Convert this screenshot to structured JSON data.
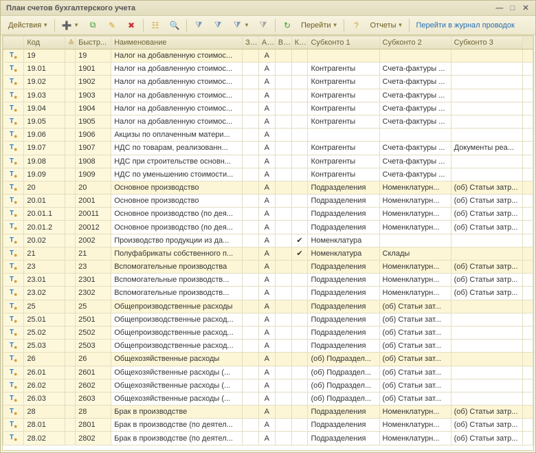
{
  "window": {
    "title": "План счетов бухгалтерского учета"
  },
  "toolbar": {
    "actions_label": "Действия",
    "goto_label": "Перейти",
    "reports_label": "Отчеты",
    "journal_label": "Перейти в журнал проводок"
  },
  "columns": {
    "icon": "",
    "code": "Код",
    "fast": "Быстр...",
    "name": "Наименование",
    "z": "З...",
    "a": "А...",
    "v": "В...",
    "k": "К...",
    "sub1": "Субконто 1",
    "sub2": "Субконто 2",
    "sub3": "Субконто 3"
  },
  "rows": [
    {
      "g": true,
      "code": "19",
      "fast": "19",
      "name": "Налог на добавленную стоимос...",
      "a": "А",
      "sub1": "",
      "sub2": "",
      "sub3": ""
    },
    {
      "code": "19.01",
      "fast": "1901",
      "name": "Налог на добавленную стоимос...",
      "a": "А",
      "sub1": "Контрагенты",
      "sub2": "Счета-фактуры ...",
      "sub3": ""
    },
    {
      "code": "19.02",
      "fast": "1902",
      "name": "Налог на добавленную стоимос...",
      "a": "А",
      "sub1": "Контрагенты",
      "sub2": "Счета-фактуры ...",
      "sub3": ""
    },
    {
      "code": "19.03",
      "fast": "1903",
      "name": "Налог на добавленную стоимос...",
      "a": "А",
      "sub1": "Контрагенты",
      "sub2": "Счета-фактуры ...",
      "sub3": ""
    },
    {
      "code": "19.04",
      "fast": "1904",
      "name": "Налог на добавленную стоимос...",
      "a": "А",
      "sub1": "Контрагенты",
      "sub2": "Счета-фактуры ...",
      "sub3": ""
    },
    {
      "code": "19.05",
      "fast": "1905",
      "name": "Налог на добавленную стоимос...",
      "a": "А",
      "sub1": "Контрагенты",
      "sub2": "Счета-фактуры ...",
      "sub3": ""
    },
    {
      "code": "19.06",
      "fast": "1906",
      "name": "Акцизы по оплаченным матери...",
      "a": "А",
      "sub1": "",
      "sub2": "",
      "sub3": ""
    },
    {
      "code": "19.07",
      "fast": "1907",
      "name": "НДС по товарам, реализованн...",
      "a": "А",
      "sub1": "Контрагенты",
      "sub2": "Счета-фактуры ...",
      "sub3": "Документы реа..."
    },
    {
      "code": "19.08",
      "fast": "1908",
      "name": "НДС при строительстве основн...",
      "a": "А",
      "sub1": "Контрагенты",
      "sub2": "Счета-фактуры ...",
      "sub3": ""
    },
    {
      "code": "19.09",
      "fast": "1909",
      "name": "НДС по уменьшению стоимости...",
      "a": "А",
      "sub1": "Контрагенты",
      "sub2": "Счета-фактуры ...",
      "sub3": ""
    },
    {
      "g": true,
      "code": "20",
      "fast": "20",
      "name": "Основное производство",
      "a": "А",
      "sub1": "Подразделения",
      "sub2": "Номенклатурн...",
      "sub3": "(об) Статьи затр..."
    },
    {
      "code": "20.01",
      "fast": "2001",
      "name": "Основное производство",
      "a": "А",
      "sub1": "Подразделения",
      "sub2": "Номенклатурн...",
      "sub3": "(об) Статьи затр..."
    },
    {
      "code": "20.01.1",
      "fast": "20011",
      "name": "Основное производство (по дея...",
      "a": "А",
      "sub1": "Подразделения",
      "sub2": "Номенклатурн...",
      "sub3": "(об) Статьи затр..."
    },
    {
      "code": "20.01.2",
      "fast": "20012",
      "name": "Основное производство (по дея...",
      "a": "А",
      "sub1": "Подразделения",
      "sub2": "Номенклатурн...",
      "sub3": "(об) Статьи затр..."
    },
    {
      "code": "20.02",
      "fast": "2002",
      "name": "Производство продукции из да...",
      "a": "А",
      "k": "✔",
      "sub1": "Номенклатура",
      "sub2": "",
      "sub3": ""
    },
    {
      "g": true,
      "code": "21",
      "fast": "21",
      "name": "Полуфабрикаты собственного п...",
      "a": "А",
      "k": "✔",
      "sub1": "Номенклатура",
      "sub2": "Склады",
      "sub3": ""
    },
    {
      "g": true,
      "code": "23",
      "fast": "23",
      "name": "Вспомогательные производства",
      "a": "А",
      "sub1": "Подразделения",
      "sub2": "Номенклатурн...",
      "sub3": "(об) Статьи затр..."
    },
    {
      "code": "23.01",
      "fast": "2301",
      "name": "Вспомогательные производств...",
      "a": "А",
      "sub1": "Подразделения",
      "sub2": "Номенклатурн...",
      "sub3": "(об) Статьи затр..."
    },
    {
      "code": "23.02",
      "fast": "2302",
      "name": "Вспомогательные производств...",
      "a": "А",
      "sub1": "Подразделения",
      "sub2": "Номенклатурн...",
      "sub3": "(об) Статьи затр..."
    },
    {
      "g": true,
      "code": "25",
      "fast": "25",
      "name": "Общепроизводственные расходы",
      "a": "А",
      "sub1": "Подразделения",
      "sub2": "(об) Статьи зат...",
      "sub3": ""
    },
    {
      "code": "25.01",
      "fast": "2501",
      "name": "Общепроизводственные расход...",
      "a": "А",
      "sub1": "Подразделения",
      "sub2": "(об) Статьи зат...",
      "sub3": ""
    },
    {
      "code": "25.02",
      "fast": "2502",
      "name": "Общепроизводственные расход...",
      "a": "А",
      "sub1": "Подразделения",
      "sub2": "(об) Статьи зат...",
      "sub3": ""
    },
    {
      "code": "25.03",
      "fast": "2503",
      "name": "Общепроизводственные расход...",
      "a": "А",
      "sub1": "Подразделения",
      "sub2": "(об) Статьи зат...",
      "sub3": ""
    },
    {
      "g": true,
      "code": "26",
      "fast": "26",
      "name": "Общехозяйственные расходы",
      "a": "А",
      "sub1": "(об) Подраздел...",
      "sub2": "(об) Статьи зат...",
      "sub3": ""
    },
    {
      "code": "26.01",
      "fast": "2601",
      "name": "Общехозяйственные расходы (...",
      "a": "А",
      "sub1": "(об) Подраздел...",
      "sub2": "(об) Статьи зат...",
      "sub3": ""
    },
    {
      "code": "26.02",
      "fast": "2602",
      "name": "Общехозяйственные расходы (...",
      "a": "А",
      "sub1": "(об) Подраздел...",
      "sub2": "(об) Статьи зат...",
      "sub3": ""
    },
    {
      "code": "26.03",
      "fast": "2603",
      "name": "Общехозяйственные расходы (...",
      "a": "А",
      "sub1": "(об) Подраздел...",
      "sub2": "(об) Статьи зат...",
      "sub3": ""
    },
    {
      "g": true,
      "code": "28",
      "fast": "28",
      "name": "Брак в производстве",
      "a": "А",
      "sub1": "Подразделения",
      "sub2": "Номенклатурн...",
      "sub3": "(об) Статьи затр..."
    },
    {
      "code": "28.01",
      "fast": "2801",
      "name": "Брак в производстве (по деятел...",
      "a": "А",
      "sub1": "Подразделения",
      "sub2": "Номенклатурн...",
      "sub3": "(об) Статьи затр..."
    },
    {
      "code": "28.02",
      "fast": "2802",
      "name": "Брак в производстве (по деятел...",
      "a": "А",
      "sub1": "Подразделения",
      "sub2": "Номенклатурн...",
      "sub3": "(об) Статьи затр..."
    }
  ]
}
